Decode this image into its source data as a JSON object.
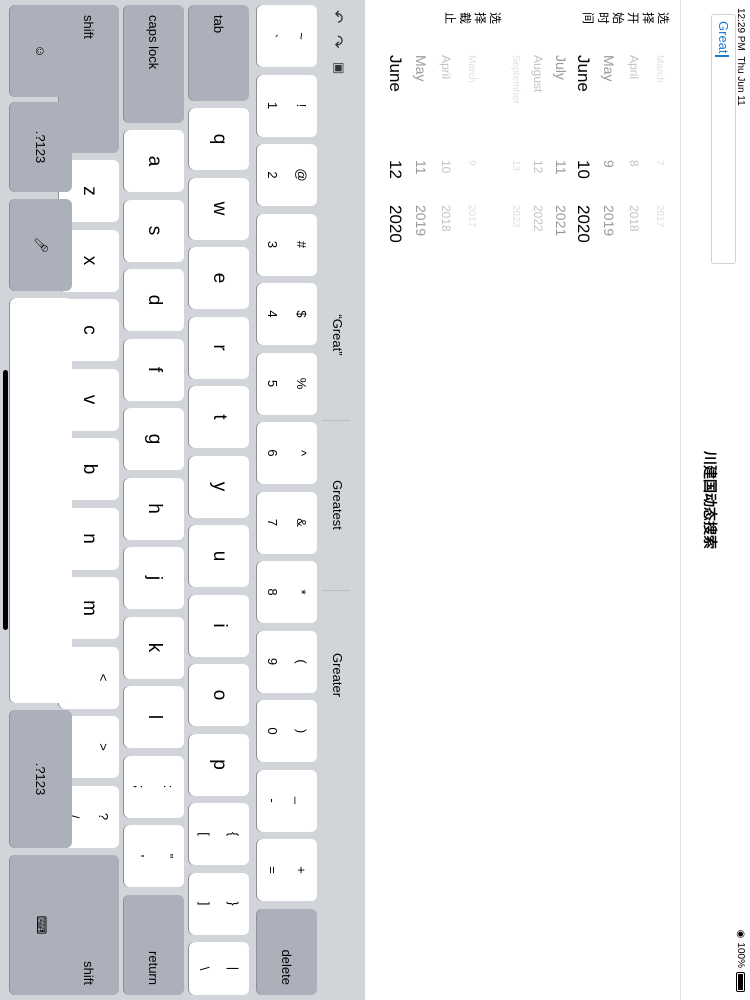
{
  "status": {
    "time": "12:29 PM",
    "date": "Thu Jun 11",
    "battery": "100%",
    "wifi_icon": "wifi-icon",
    "battery_icon": "battery-icon"
  },
  "nav": {
    "title": "川建国动态搜索"
  },
  "search": {
    "value": "Great"
  },
  "start_picker": {
    "label_chars": [
      "选",
      "择",
      "开",
      "始",
      "时",
      "间"
    ],
    "rows": [
      {
        "m": "March",
        "d": "7",
        "y": "2017"
      },
      {
        "m": "April",
        "d": "8",
        "y": "2018"
      },
      {
        "m": "May",
        "d": "9",
        "y": "2019"
      },
      {
        "m": "June",
        "d": "10",
        "y": "2020"
      },
      {
        "m": "July",
        "d": "11",
        "y": "2021"
      },
      {
        "m": "August",
        "d": "12",
        "y": "2022"
      },
      {
        "m": "September",
        "d": "13",
        "y": "2023"
      }
    ]
  },
  "end_picker": {
    "label_chars": [
      "选",
      "择",
      "截",
      "止"
    ],
    "rows": [
      {
        "m": "March",
        "d": "9",
        "y": "2017"
      },
      {
        "m": "April",
        "d": "10",
        "y": "2018"
      },
      {
        "m": "May",
        "d": "11",
        "y": "2019"
      },
      {
        "m": "June",
        "d": "12",
        "y": "2020"
      }
    ]
  },
  "keyboard": {
    "suggestions": [
      "“Great”",
      "Greatest",
      "Greater"
    ],
    "icons": {
      "undo": "undo-icon",
      "redo": "redo-icon",
      "paste": "paste-icon",
      "emoji": "emoji-icon",
      "mic": "microphone-icon",
      "hide": "keyboard-hide-icon"
    },
    "number_row": [
      {
        "top": "~",
        "bot": "`"
      },
      {
        "top": "!",
        "bot": "1"
      },
      {
        "top": "@",
        "bot": "2"
      },
      {
        "top": "#",
        "bot": "3"
      },
      {
        "top": "$",
        "bot": "4"
      },
      {
        "top": "%",
        "bot": "5"
      },
      {
        "top": "^",
        "bot": "6"
      },
      {
        "top": "&",
        "bot": "7"
      },
      {
        "top": "*",
        "bot": "8"
      },
      {
        "top": "(",
        "bot": "9"
      },
      {
        "top": ")",
        "bot": "0"
      },
      {
        "top": "_",
        "bot": "-"
      },
      {
        "top": "+",
        "bot": "="
      }
    ],
    "delete": "delete",
    "tab": "tab",
    "row_q": [
      "q",
      "w",
      "e",
      "r",
      "t",
      "y",
      "u",
      "i",
      "o",
      "p"
    ],
    "row_q_extra": [
      {
        "top": "{",
        "bot": "["
      },
      {
        "top": "}",
        "bot": "]"
      },
      {
        "top": "|",
        "bot": "\\"
      }
    ],
    "caps": "caps lock",
    "row_a": [
      "a",
      "s",
      "d",
      "f",
      "g",
      "h",
      "j",
      "k",
      "l"
    ],
    "row_a_extra": [
      {
        "top": ":",
        "bot": ";"
      },
      {
        "top": "\"",
        "bot": "'"
      }
    ],
    "return": "return",
    "shift": "shift",
    "row_z": [
      "z",
      "x",
      "c",
      "v",
      "b",
      "n",
      "m"
    ],
    "row_z_extra": [
      {
        "top": "<",
        "bot": ","
      },
      {
        "top": ">",
        "bot": "."
      },
      {
        "top": "?",
        "bot": "/"
      }
    ],
    "numbers_label": ".?123"
  }
}
